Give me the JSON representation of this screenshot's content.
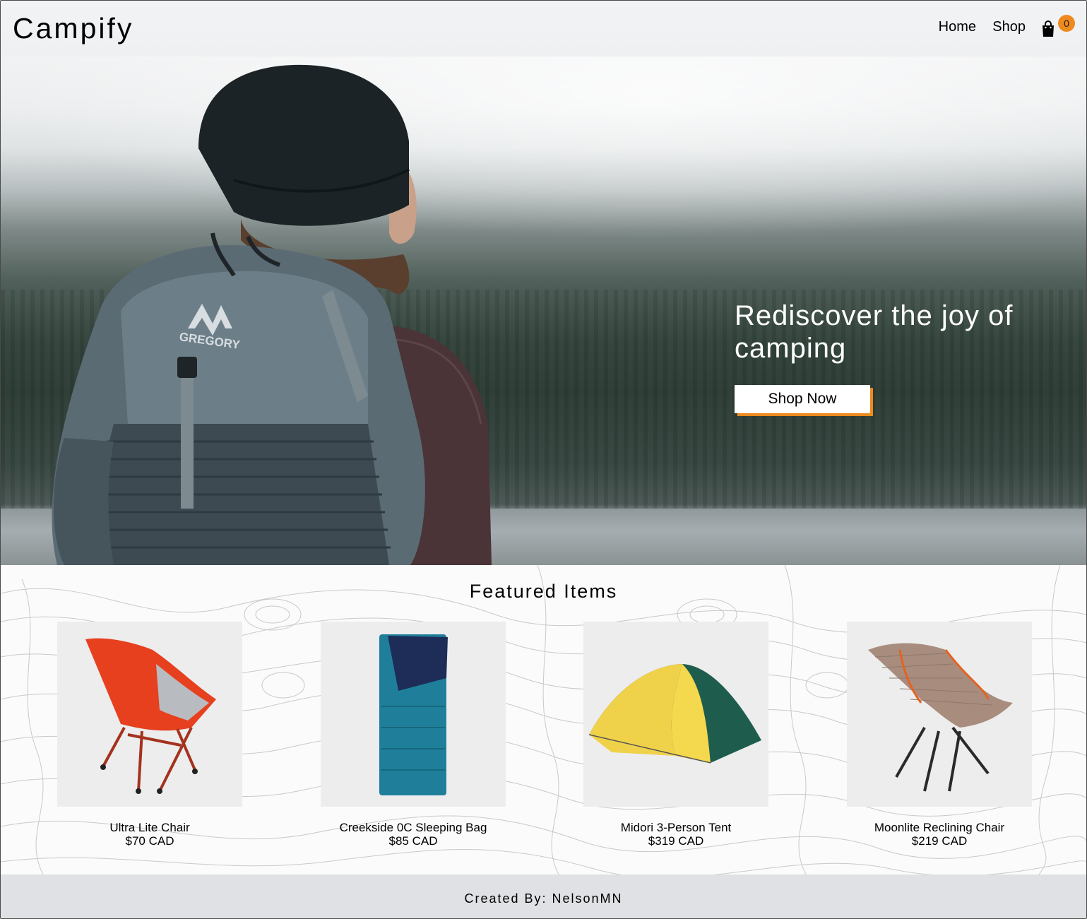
{
  "header": {
    "logo": "Campify",
    "nav": {
      "home": "Home",
      "shop": "Shop"
    },
    "cart": {
      "icon": "shopping-bag-icon",
      "count": "0",
      "badge_color": "#ee8a1e"
    }
  },
  "hero": {
    "title": "Rediscover the joy of camping",
    "button": "Shop Now",
    "button_accent": "#ee8a1e",
    "backpack_brand": "GREGORY"
  },
  "featured": {
    "title": "Featured Items",
    "items": [
      {
        "name": "Ultra Lite Chair",
        "price": "$70 CAD"
      },
      {
        "name": "Creekside 0C Sleeping Bag",
        "price": "$85 CAD"
      },
      {
        "name": "Midori 3-Person Tent",
        "price": "$319 CAD"
      },
      {
        "name": "Moonlite Reclining Chair",
        "price": "$219 CAD"
      }
    ]
  },
  "footer": {
    "text": "Created By: NelsonMN"
  }
}
